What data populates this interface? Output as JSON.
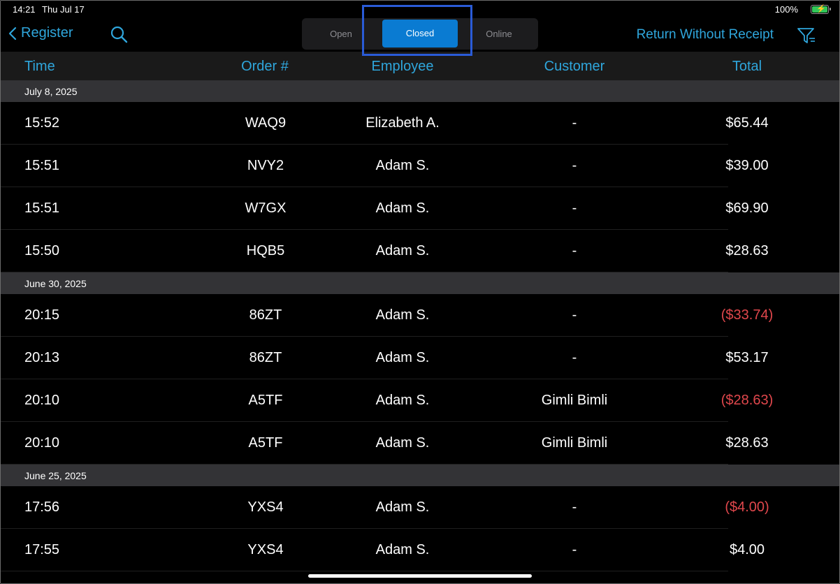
{
  "status": {
    "time": "14:21",
    "date": "Thu Jul 17",
    "battery": "100%"
  },
  "nav": {
    "back_label": "Register",
    "segments": [
      "Open",
      "Closed",
      "Online"
    ],
    "selected_segment": "Closed",
    "return_label": "Return Without Receipt"
  },
  "columns": {
    "time": "Time",
    "order": "Order #",
    "employee": "Employee",
    "customer": "Customer",
    "total": "Total"
  },
  "colors": {
    "accent": "#2fa6dc",
    "selected": "#0a7bd2",
    "negative": "#e0474c",
    "group_bg": "#333336",
    "highlight": "#2a5bd7"
  },
  "groups": [
    {
      "date": "July 8, 2025",
      "rows": [
        {
          "time": "15:52",
          "order": "WAQ9",
          "employee": "Elizabeth A.",
          "customer": "-",
          "total": "$65.44",
          "negative": false
        },
        {
          "time": "15:51",
          "order": "NVY2",
          "employee": "Adam S.",
          "customer": "-",
          "total": "$39.00",
          "negative": false
        },
        {
          "time": "15:51",
          "order": "W7GX",
          "employee": "Adam S.",
          "customer": "-",
          "total": "$69.90",
          "negative": false
        },
        {
          "time": "15:50",
          "order": "HQB5",
          "employee": "Adam S.",
          "customer": "-",
          "total": "$28.63",
          "negative": false
        }
      ]
    },
    {
      "date": "June 30, 2025",
      "rows": [
        {
          "time": "20:15",
          "order": "86ZT",
          "employee": "Adam S.",
          "customer": "-",
          "total": "($33.74)",
          "negative": true
        },
        {
          "time": "20:13",
          "order": "86ZT",
          "employee": "Adam S.",
          "customer": "-",
          "total": "$53.17",
          "negative": false
        },
        {
          "time": "20:10",
          "order": "A5TF",
          "employee": "Adam S.",
          "customer": "Gimli Bimli",
          "total": "($28.63)",
          "negative": true
        },
        {
          "time": "20:10",
          "order": "A5TF",
          "employee": "Adam S.",
          "customer": "Gimli Bimli",
          "total": "$28.63",
          "negative": false
        }
      ]
    },
    {
      "date": "June 25, 2025",
      "rows": [
        {
          "time": "17:56",
          "order": "YXS4",
          "employee": "Adam S.",
          "customer": "-",
          "total": "($4.00)",
          "negative": true
        },
        {
          "time": "17:55",
          "order": "YXS4",
          "employee": "Adam S.",
          "customer": "-",
          "total": "$4.00",
          "negative": false
        }
      ]
    }
  ]
}
